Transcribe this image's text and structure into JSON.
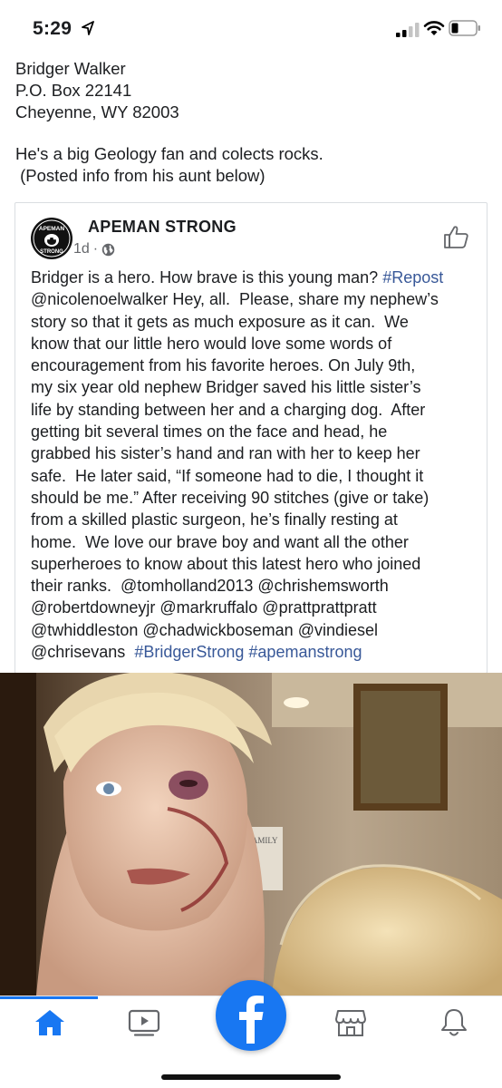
{
  "status_bar": {
    "time": "5:29"
  },
  "intro_lines": [
    "Bridger Walker",
    "P.O. Box 22141",
    "Cheyenne, WY 82003",
    "He's a big Geology fan and colects rocks.",
    " (Posted info from his aunt below)"
  ],
  "post": {
    "page_name": "APEMAN STRONG",
    "time_ago": "1d",
    "separator": "·",
    "avatar_text_top": "APEMAN",
    "avatar_text_bottom": "STRONG",
    "body_lines": [
      [
        {
          "t": "Bridger is a hero. How brave is this young man? "
        },
        {
          "t": "#Repost",
          "link": true
        }
      ],
      [
        {
          "t": "@nicolenoelwalker Hey, all.  Please, share my nephew’s"
        }
      ],
      [
        {
          "t": "story so that it gets as much exposure as it can.  We"
        }
      ],
      [
        {
          "t": "know that our little hero would love some words of"
        }
      ],
      [
        {
          "t": "encouragement from his favorite heroes. On July 9th,"
        }
      ],
      [
        {
          "t": "my six year old nephew Bridger saved his little sister’s"
        }
      ],
      [
        {
          "t": "life by standing between her and a charging dog.  After"
        }
      ],
      [
        {
          "t": "getting bit several times on the face and head, he"
        }
      ],
      [
        {
          "t": "grabbed his sister’s hand and ran with her to keep her"
        }
      ],
      [
        {
          "t": "safe.  He later said, “If someone had to die, I thought it"
        }
      ],
      [
        {
          "t": "should be me.” After receiving 90 stitches (give or take)"
        }
      ],
      [
        {
          "t": "from a skilled plastic surgeon, he’s finally resting at"
        }
      ],
      [
        {
          "t": "home.  We love our brave boy and want all the other"
        }
      ],
      [
        {
          "t": "superheroes to know about this latest hero who joined"
        }
      ],
      [
        {
          "t": "their ranks.  @tomholland2013 @chrishemsworth"
        }
      ],
      [
        {
          "t": "@robertdowneyjr @markruffalo @prattprattpratt"
        }
      ],
      [
        {
          "t": "@twhiddleston @chadwickboseman @vindiesel"
        }
      ],
      [
        {
          "t": "@chrisevans  "
        },
        {
          "t": "#BridgerStrong",
          "link": true
        },
        {
          "t": " "
        },
        {
          "t": "#apemanstrong",
          "link": true
        }
      ]
    ],
    "photo_sign_text": "FAMILY"
  },
  "nav": {
    "items": [
      {
        "name": "home-icon",
        "active": true
      },
      {
        "name": "watch-icon",
        "active": false
      },
      {
        "name": "facebook-logo-icon",
        "active": false
      },
      {
        "name": "marketplace-icon",
        "active": false
      },
      {
        "name": "notifications-bell-icon",
        "active": false
      }
    ],
    "accent": "#1877f2",
    "icon_color": "#65676b"
  },
  "colors": {
    "link": "#385898",
    "text": "#1c1e21",
    "meta": "#65676b"
  }
}
